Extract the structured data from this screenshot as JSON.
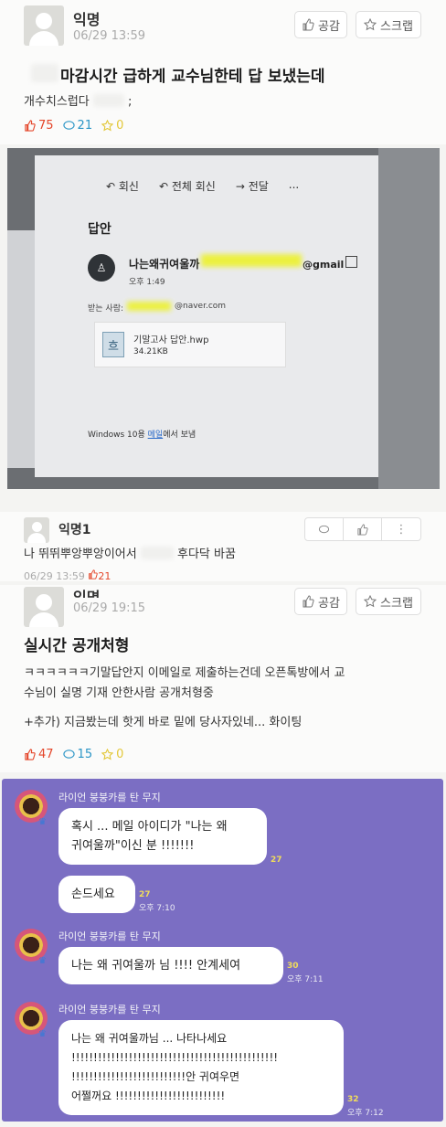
{
  "post1": {
    "author": "익명",
    "date": "06/29 13:59",
    "like_button": "공감",
    "scrap_button": "스크랩",
    "title": "마감시간 급하게 교수님한테 답 보냈는데",
    "body": "개수치스럽다",
    "body_suffix": ";",
    "stats": {
      "likes": "75",
      "comments": "21",
      "scraps": "0"
    }
  },
  "photo": {
    "toolbar": {
      "reply": "회신",
      "reply_all": "전체 회신",
      "forward": "전달",
      "more": "..."
    },
    "heading": "답안",
    "sender_name": "나는왜귀여울까",
    "sender_domain": "@gmail",
    "sent_time": "오후 1:49",
    "recipient_label": "받는 사람:",
    "recipient_domain": "@naver.com",
    "attachment_name": "기말고사 답안.hwp",
    "attachment_size": "34.21KB",
    "sent_via_prefix": "Windows 10용 ",
    "sent_via_link": "메일",
    "sent_via_suffix": "에서 보냄"
  },
  "comment": {
    "author": "익명1",
    "text_a": "나 뛰뛰뿌앙뿌앙이어서",
    "text_b": "후다닥 바꿈",
    "date": "06/29 13:59",
    "likes": "21"
  },
  "post2": {
    "author": "익명",
    "date": "06/29 19:15",
    "like_button": "공감",
    "scrap_button": "스크랩",
    "title": "실시간 공개처형",
    "body_lines": [
      "ㅋㅋㅋㅋㅋㅋ기말답안지 이메일로 제출하는건데 오픈톡방에서 교",
      "수님이 실명 기재 안한사람 공개처형중",
      "",
      "+추가) 지금봤는데 핫게 바로 밑에 당사자있네... 화이팅"
    ],
    "stats": {
      "likes": "47",
      "comments": "15",
      "scraps": "0"
    }
  },
  "chat": {
    "sender": "라이언 붕붕카를 탄 무지",
    "messages": [
      {
        "text_lines": [
          "혹시 ... 메일 아이디가 \"나는 왜",
          "귀여울까\"이신 분 !!!!!!!"
        ],
        "count": "27",
        "time": ""
      },
      {
        "text_lines": [
          "손드세요"
        ],
        "count": "27",
        "time": "오후 7:10"
      },
      {
        "text_lines": [
          "나는 왜 귀여울까 님 !!!! 안계세여"
        ],
        "count": "30",
        "time": "오후 7:11"
      },
      {
        "text_lines": [
          "나는 왜 귀여울까님 ... 나타나세요",
          "!!!!!!!!!!!!!!!!!!!!!!!!!!!!!!!!!!!!!!!!!!!!!!!",
          "!!!!!!!!!!!!!!!!!!!!!!!!!!안 귀여우면",
          "어쩔꺼요 !!!!!!!!!!!!!!!!!!!!!!!!!"
        ],
        "count": "32",
        "time": "오후 7:12"
      }
    ]
  }
}
